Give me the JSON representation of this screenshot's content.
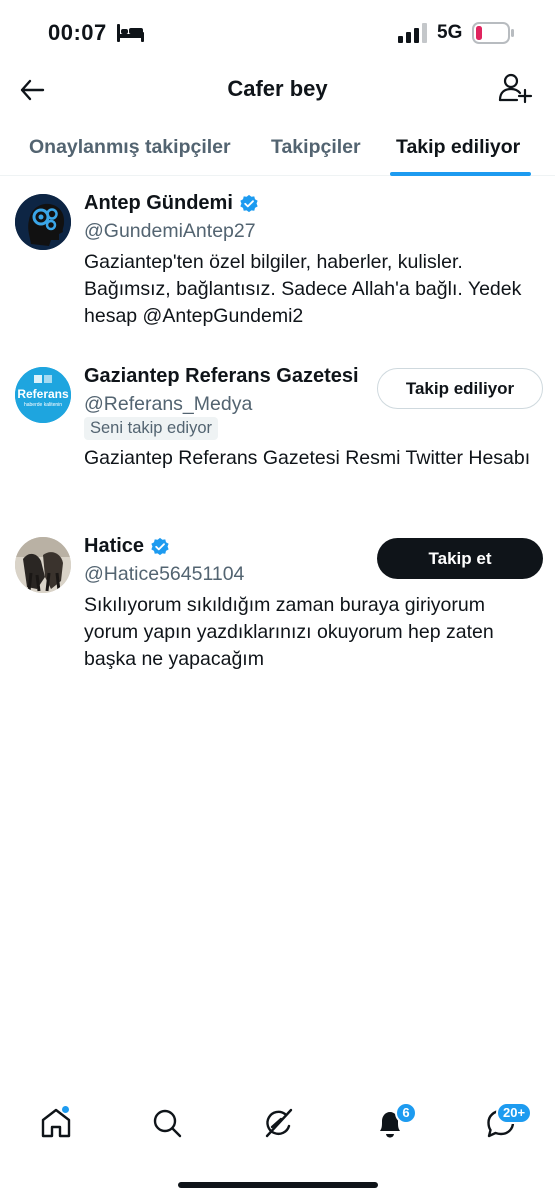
{
  "status": {
    "time": "00:07",
    "network": "5G"
  },
  "header": {
    "title": "Cafer bey"
  },
  "tabs": [
    {
      "label": "Onaylanmış takipçiler",
      "active": false
    },
    {
      "label": "Takipçiler",
      "active": false
    },
    {
      "label": "Takip ediliyor",
      "active": true
    }
  ],
  "users": [
    {
      "name": "Antep Gündemi",
      "verified": true,
      "handle": "@GundemiAntep27",
      "bio": "Gaziantep'ten özel bilgiler, haberler, kulisler. Bağımsız, bağlantısız. Sadece Allah'a bağlı. Yedek hesap @AntepGundemi2"
    },
    {
      "name": "Gaziantep Referans Gazetesi",
      "verified": false,
      "handle": "@Referans_Medya",
      "follows_you": "Seni takip ediyor",
      "button": "Takip ediliyor",
      "avatar_text": "Referans",
      "avatar_subtext": "haberde kalitenin",
      "bio": "Gaziantep Referans Gazetesi Resmi Twitter Hesabı"
    },
    {
      "name": "Hatice",
      "verified": true,
      "handle": "@Hatice56451104",
      "button": "Takip et",
      "bio": "Sıkılıyorum sıkıldığım zaman buraya giriyorum yorum yapın yazdıklarınızı okuyorum hep zaten başka ne yapacağım"
    }
  ],
  "bottom_nav": {
    "notifications_badge": "6",
    "messages_badge": "20+"
  },
  "colors": {
    "accent": "#1d9bf0",
    "text": "#0f1419",
    "secondary": "#536471",
    "battery_low": "#e0245e"
  }
}
